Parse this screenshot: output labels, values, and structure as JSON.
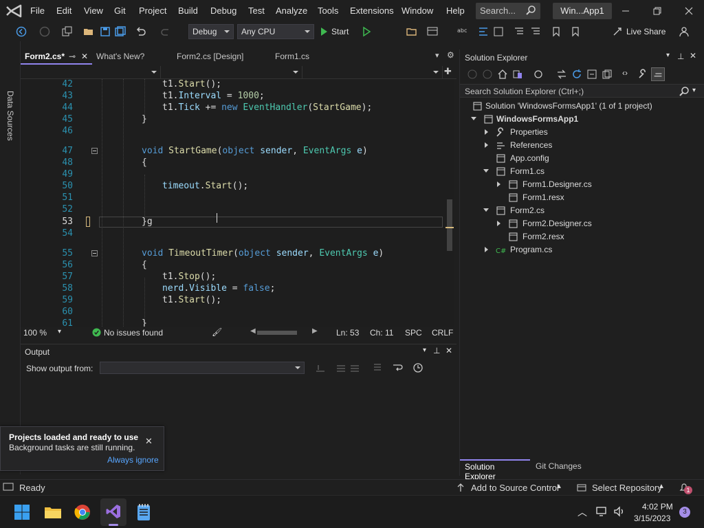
{
  "titlebar": {
    "menus": [
      "File",
      "Edit",
      "View",
      "Git",
      "Project",
      "Build",
      "Debug",
      "Test",
      "Analyze",
      "Tools",
      "Extensions",
      "Window",
      "Help"
    ],
    "search_placeholder": "Search...",
    "window_title": "Win...App1"
  },
  "toolbar": {
    "config": "Debug",
    "platform": "Any CPU",
    "start_label": "Start",
    "live_share": "Live Share"
  },
  "leftstrip": {
    "label": "Data Sources"
  },
  "tabs": [
    {
      "label": "Form2.cs*",
      "active": true
    },
    {
      "label": "What's New?"
    },
    {
      "label": "Form2.cs [Design]"
    },
    {
      "label": "Form1.cs"
    }
  ],
  "editor": {
    "lines": [
      {
        "n": "42",
        "tokens": [
          [
            "pl",
            "t1."
          ],
          [
            "fn",
            "Start"
          ],
          [
            "pl",
            "();"
          ]
        ],
        "indent": 2
      },
      {
        "n": "43",
        "tokens": [
          [
            "pl",
            "t1."
          ],
          [
            "pa",
            "Interval"
          ],
          [
            "pl",
            " = "
          ],
          [
            "nu",
            "1000"
          ],
          [
            "pl",
            ";"
          ]
        ],
        "indent": 2
      },
      {
        "n": "44",
        "tokens": [
          [
            "pl",
            "t1."
          ],
          [
            "pa",
            "Tick"
          ],
          [
            "pl",
            " += "
          ],
          [
            "kw",
            "new"
          ],
          [
            "pl",
            " "
          ],
          [
            "ty",
            "EventHandler"
          ],
          [
            "pl",
            "("
          ],
          [
            "fn",
            "StartGame"
          ],
          [
            "pl",
            ");"
          ]
        ],
        "indent": 2
      },
      {
        "n": "45",
        "tokens": [
          [
            "pl",
            "}"
          ]
        ],
        "indent": 1
      },
      {
        "n": "46",
        "tokens": [],
        "indent": 0
      },
      {
        "n": "47",
        "tokens": [
          [
            "kw",
            "void"
          ],
          [
            "pl",
            " "
          ],
          [
            "fn",
            "StartGame"
          ],
          [
            "pl",
            "("
          ],
          [
            "kw",
            "object"
          ],
          [
            "pl",
            " "
          ],
          [
            "pa",
            "sender"
          ],
          [
            "pl",
            ", "
          ],
          [
            "ty",
            "EventArgs"
          ],
          [
            "pl",
            " "
          ],
          [
            "pa",
            "e"
          ],
          [
            "pl",
            ")"
          ]
        ],
        "indent": 1
      },
      {
        "n": "48",
        "tokens": [
          [
            "pl",
            "{"
          ]
        ],
        "indent": 1
      },
      {
        "n": "49",
        "tokens": [],
        "indent": 0
      },
      {
        "n": "50",
        "tokens": [
          [
            "pa",
            "timeout"
          ],
          [
            "pl",
            "."
          ],
          [
            "fn",
            "Start"
          ],
          [
            "pl",
            "();"
          ]
        ],
        "indent": 2
      },
      {
        "n": "51",
        "tokens": [],
        "indent": 0
      },
      {
        "n": "52",
        "tokens": [],
        "indent": 0
      },
      {
        "n": "53",
        "tokens": [
          [
            "pl",
            "}g"
          ]
        ],
        "indent": 1
      },
      {
        "n": "54",
        "tokens": [],
        "indent": 0
      },
      {
        "n": "55",
        "tokens": [
          [
            "kw",
            "void"
          ],
          [
            "pl",
            " "
          ],
          [
            "fn",
            "TimeoutTimer"
          ],
          [
            "pl",
            "("
          ],
          [
            "kw",
            "object"
          ],
          [
            "pl",
            " "
          ],
          [
            "pa",
            "sender"
          ],
          [
            "pl",
            ", "
          ],
          [
            "ty",
            "EventArgs"
          ],
          [
            "pl",
            " "
          ],
          [
            "pa",
            "e"
          ],
          [
            "pl",
            ")"
          ]
        ],
        "indent": 1
      },
      {
        "n": "56",
        "tokens": [
          [
            "pl",
            "{"
          ]
        ],
        "indent": 1
      },
      {
        "n": "57",
        "tokens": [
          [
            "pl",
            "t1."
          ],
          [
            "fn",
            "Stop"
          ],
          [
            "pl",
            "();"
          ]
        ],
        "indent": 2
      },
      {
        "n": "58",
        "tokens": [
          [
            "pa",
            "nerd"
          ],
          [
            "pl",
            "."
          ],
          [
            "pa",
            "Visible"
          ],
          [
            "pl",
            " = "
          ],
          [
            "kw",
            "false"
          ],
          [
            "pl",
            ";"
          ]
        ],
        "indent": 2
      },
      {
        "n": "59",
        "tokens": [
          [
            "pl",
            "t1."
          ],
          [
            "fn",
            "Start"
          ],
          [
            "pl",
            "();"
          ]
        ],
        "indent": 2
      },
      {
        "n": "60",
        "tokens": [],
        "indent": 0
      },
      {
        "n": "61",
        "tokens": [
          [
            "pl",
            "}"
          ]
        ],
        "indent": 1
      }
    ]
  },
  "editor_status": {
    "zoom": "100 %",
    "issues": "No issues found",
    "line": "Ln: 53",
    "col": "Ch: 11",
    "whitespace": "SPC",
    "line_ending": "CRLF"
  },
  "output": {
    "title": "Output",
    "show_from_label": "Show output from:",
    "show_from_value": ""
  },
  "toast": {
    "title": "Projects loaded and ready to use",
    "body": "Background tasks are still running.",
    "action": "Always ignore"
  },
  "solution_explorer": {
    "title": "Solution Explorer",
    "search_placeholder": "Search Solution Explorer (Ctrl+;)",
    "items": [
      {
        "label": "Solution 'WindowsFormsApp1' (1 of 1 project)",
        "level": 0,
        "icon": "solution-icon",
        "expander": "none"
      },
      {
        "label": "WindowsFormsApp1",
        "level": 0,
        "icon": "csharp-project-icon",
        "expander": "open",
        "bold": true
      },
      {
        "label": "Properties",
        "level": 1,
        "icon": "wrench-icon",
        "expander": "closed"
      },
      {
        "label": "References",
        "level": 1,
        "icon": "references-icon",
        "expander": "closed"
      },
      {
        "label": "App.config",
        "level": 1,
        "icon": "config-file-icon",
        "expander": "none"
      },
      {
        "label": "Form1.cs",
        "level": 1,
        "icon": "form-icon",
        "expander": "open"
      },
      {
        "label": "Form1.Designer.cs",
        "level": 2,
        "icon": "designer-file-icon",
        "expander": "closed"
      },
      {
        "label": "Form1.resx",
        "level": 2,
        "icon": "resx-icon",
        "expander": "none"
      },
      {
        "label": "Form2.cs",
        "level": 1,
        "icon": "form-icon",
        "expander": "open"
      },
      {
        "label": "Form2.Designer.cs",
        "level": 2,
        "icon": "designer-file-icon",
        "expander": "closed"
      },
      {
        "label": "Form2.resx",
        "level": 2,
        "icon": "resx-icon",
        "expander": "none"
      },
      {
        "label": "Program.cs",
        "level": 1,
        "icon": "csharp-file-icon",
        "expander": "closed"
      }
    ],
    "bottom_tabs": [
      "Solution Explorer",
      "Git Changes"
    ]
  },
  "statusbar": {
    "ready": "Ready",
    "source_control": "Add to Source Control",
    "repository": "Select Repository",
    "notifications": "1"
  },
  "taskbar": {
    "time": "4:02 PM",
    "date": "3/15/2023",
    "badge": "3"
  },
  "colors": {
    "accent": "#9184ee",
    "keyword": "#569cd6",
    "type": "#4ec9b0",
    "method": "#dcdcaa",
    "identifier": "#9cdcfe",
    "number": "#b5cea8",
    "line_number": "#2b91af"
  }
}
